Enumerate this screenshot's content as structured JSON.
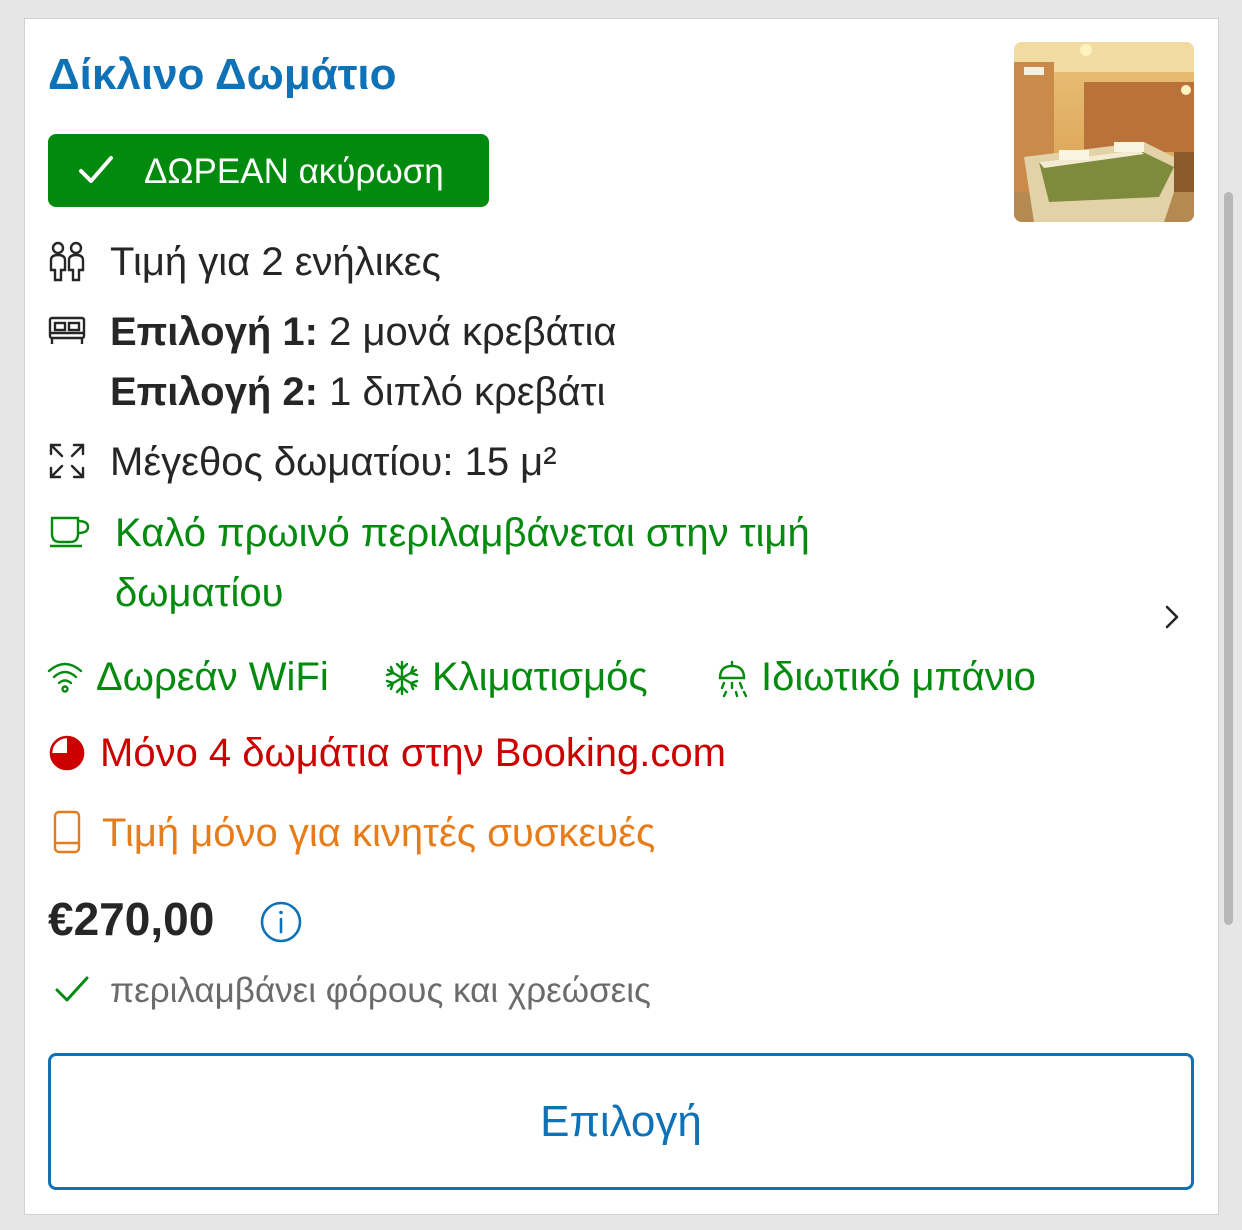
{
  "room": {
    "title": "Δίκλινο Δωμάτιο",
    "cancellation_badge": "ΔΩΡΕΑΝ ακύρωση",
    "occupancy": "Τιμή για 2 ενήλικες",
    "bed_option_1_label": "Επιλογή 1:",
    "bed_option_1_value": "2 μονά κρεβάτια",
    "bed_option_2_label": "Επιλογή 2:",
    "bed_option_2_value": "1 διπλό κρεβάτι",
    "size": "Μέγεθος δωματίου: 15 μ²",
    "breakfast_line1": "Καλό πρωινό περιλαμβάνεται στην τιμή",
    "breakfast_line2": "δωματίου",
    "amenities": [
      "Δωρεάν WiFi",
      "Κλιματισμός",
      "Ιδιωτικό μπάνιο"
    ],
    "availability": "Μόνο 4 δωμάτια στην Booking.com",
    "mobile_price": "Τιμή μόνο για κινητές συσκευές",
    "price": "€270,00",
    "tax_note": "περιλαμβάνει φόρους και χρεώσεις",
    "select_button": "Επιλογή"
  },
  "icons": {
    "occupancy": "people-icon",
    "bed": "bed-icon",
    "size": "expand-icon",
    "breakfast": "coffee-cup-icon",
    "wifi": "wifi-icon",
    "ac": "snowflake-icon",
    "bath": "shower-icon",
    "availability": "pie-chart-icon",
    "mobile": "mobile-phone-icon",
    "info": "info-icon",
    "chevron": "chevron-right-icon"
  },
  "colors": {
    "brand_blue": "#0f72b6",
    "badge_green": "#028a0e",
    "text_green": "#048a0e",
    "alert_red": "#cc0000",
    "mobile_orange": "#e77d1a"
  },
  "availability_fraction": 0.75
}
